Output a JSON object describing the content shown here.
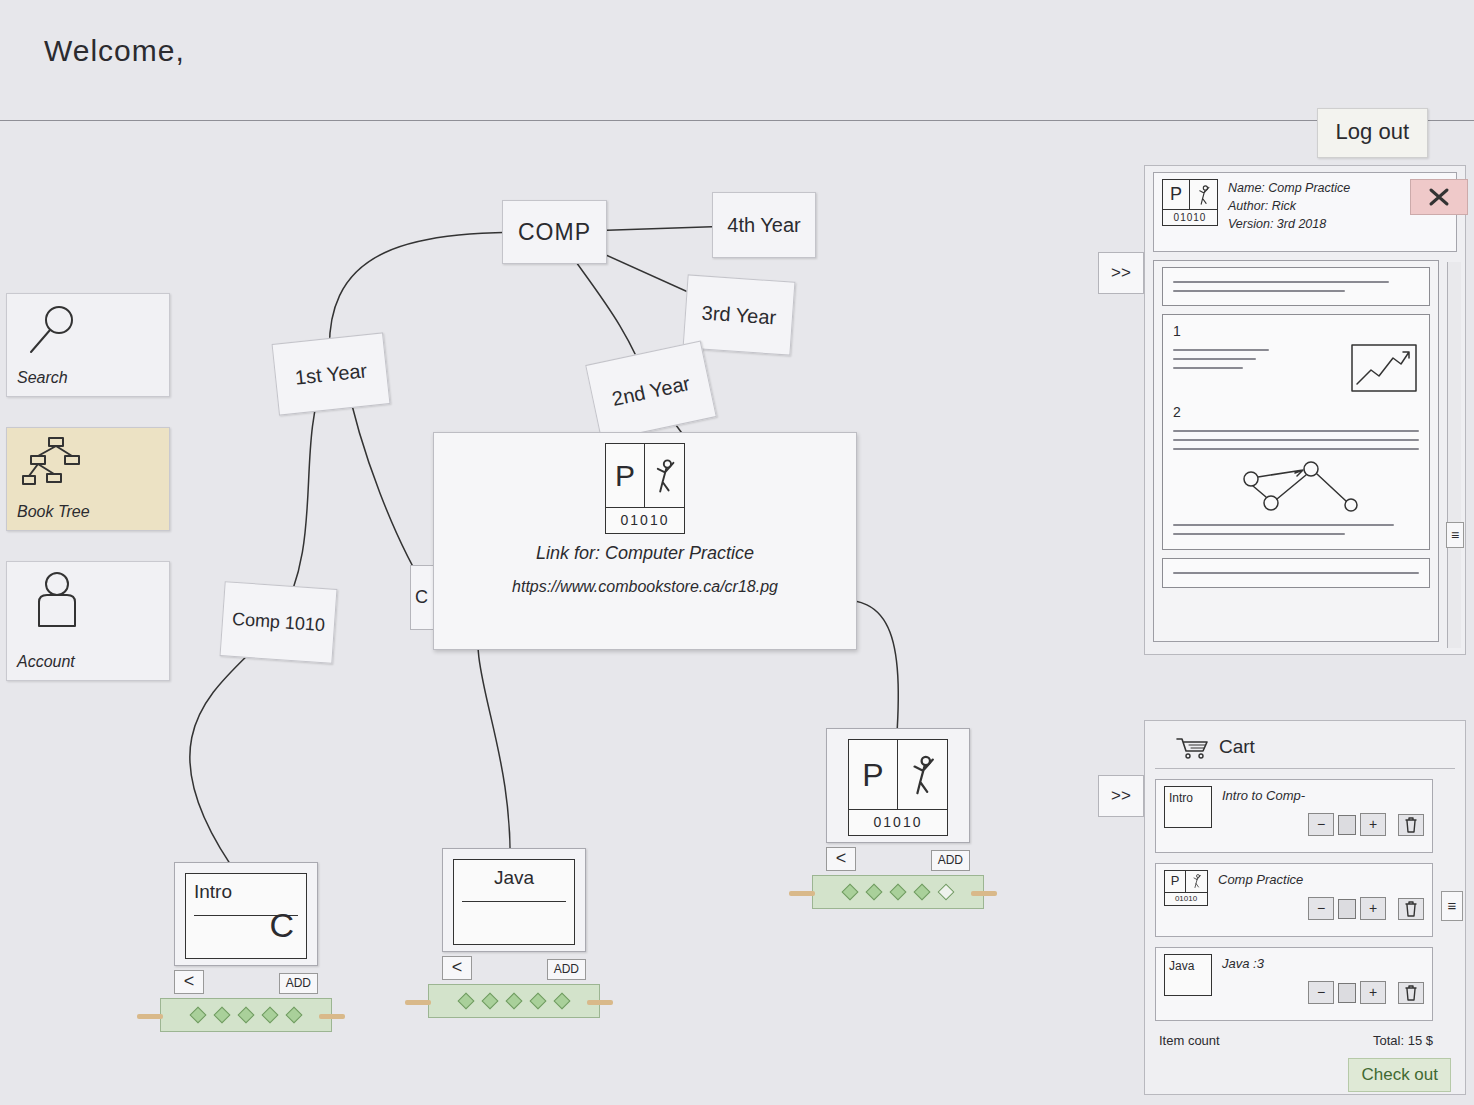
{
  "header": {
    "greeting": "Welcome,",
    "logout": "Log out"
  },
  "sidebar": {
    "items": [
      {
        "label": "Search",
        "selected": false
      },
      {
        "label": "Book Tree",
        "selected": true
      },
      {
        "label": "Account",
        "selected": false
      }
    ]
  },
  "tree": {
    "nodes": [
      {
        "label": "COMP"
      },
      {
        "label": "4th Year"
      },
      {
        "label": "3rd Year"
      },
      {
        "label": "2nd Year"
      },
      {
        "label": "1st Year"
      },
      {
        "label": "Comp 1010"
      }
    ],
    "hidden_card": "C"
  },
  "popup": {
    "logo": {
      "letter": "P",
      "code": "01010"
    },
    "title": "Link for: Computer Practice",
    "url": "https://www.combookstore.ca/cr18.pg"
  },
  "books": [
    {
      "kind": "text",
      "title": "Intro",
      "mark": "C",
      "back": "<",
      "add": "ADD",
      "stars": 5
    },
    {
      "kind": "text",
      "title": "Java",
      "back": "<",
      "add": "ADD",
      "stars": 5
    },
    {
      "kind": "logo",
      "logo": {
        "letter": "P",
        "code": "01010"
      },
      "back": "<",
      "add": "ADD",
      "stars": 4
    }
  ],
  "detail": {
    "toggle": ">>",
    "logo": {
      "letter": "P",
      "code": "01010"
    },
    "name": "Name: Comp Practice",
    "author": "Author: Rick",
    "version": "Version: 3rd 2018",
    "sections": [
      "1",
      "2"
    ],
    "scroll_handle": "≡"
  },
  "cart": {
    "title": "Cart",
    "toggle": ">>",
    "items": [
      {
        "kind": "text",
        "thumb": "Intro",
        "name": "Intro to Comp-"
      },
      {
        "kind": "logo",
        "logo": {
          "letter": "P",
          "code": "01010"
        },
        "name": "Comp Practice"
      },
      {
        "kind": "text",
        "thumb": "Java",
        "name": "Java :3"
      }
    ],
    "minus": "−",
    "plus": "+",
    "count_label": "Item count",
    "total": "Total: 15 $",
    "checkout": "Check out",
    "scroll_handle": "≡"
  }
}
